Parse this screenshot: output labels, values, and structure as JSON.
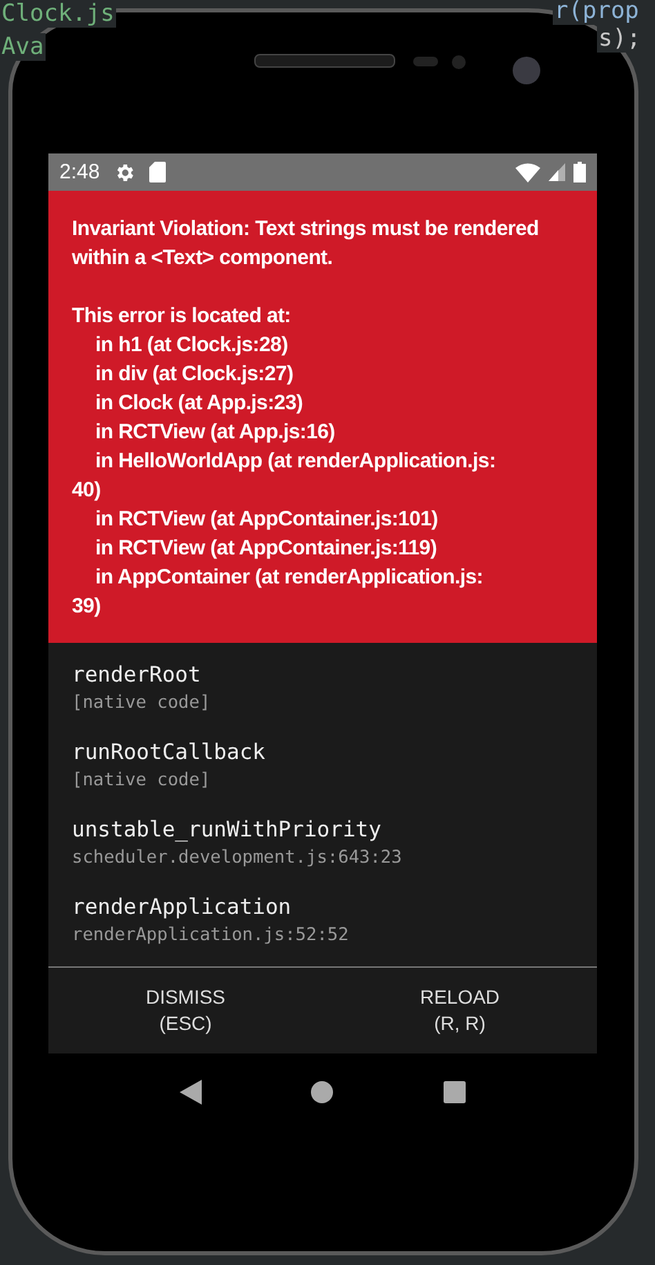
{
  "background_code": [
    "Clock.js",
    "Ava",
    "r(prop",
    "s);"
  ],
  "status_bar": {
    "time": "2:48"
  },
  "error": {
    "message": "Invariant Violation: Text strings must be rendered within a <Text> component.",
    "location_heading": "This error is located at:",
    "locations": [
      "in h1 (at Clock.js:28)",
      "in div (at Clock.js:27)",
      "in Clock (at App.js:23)",
      "in RCTView (at App.js:16)",
      "in HelloWorldApp (at renderApplication.js:\n40)",
      "in RCTView (at AppContainer.js:101)",
      "in RCTView (at AppContainer.js:119)",
      "in AppContainer (at renderApplication.js:\n39)"
    ]
  },
  "stack": [
    {
      "function": "renderRoot",
      "location": "[native code]"
    },
    {
      "function": "runRootCallback",
      "location": "[native code]"
    },
    {
      "function": "unstable_runWithPriority",
      "location": "scheduler.development.js:643:23"
    },
    {
      "function": "renderApplication",
      "location": "renderApplication.js:52:52"
    }
  ],
  "buttons": [
    {
      "label": "DISMISS",
      "shortcut": "(ESC)"
    },
    {
      "label": "RELOAD",
      "shortcut": "(R, R)"
    }
  ]
}
